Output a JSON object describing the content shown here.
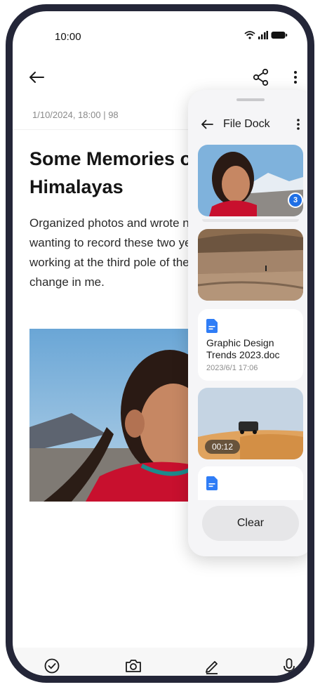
{
  "status_bar": {
    "time": "10:00"
  },
  "note": {
    "meta": "1/10/2024, 18:00  |  98",
    "title": "Some Memories of the Himalayas",
    "body": "Organized photos and wrote notes off and on, wanting to record these two years of living and working at the third pole of the earth brought a change in me."
  },
  "dock": {
    "title": "File Dock",
    "badge_count": "3",
    "items": [
      {
        "type": "image",
        "subject": "girl-portrait"
      },
      {
        "type": "image",
        "subject": "plateau-landscape"
      },
      {
        "type": "document",
        "name": "Graphic Design Trends 2023.doc",
        "date": "2023/6/1  17:06"
      },
      {
        "type": "video",
        "subject": "desert-car",
        "duration": "00:12"
      },
      {
        "type": "document"
      }
    ],
    "clear_label": "Clear"
  },
  "icons": {
    "top_bar": [
      "back-arrow-icon",
      "share-icon",
      "more-vertical-icon"
    ],
    "bottom_bar": [
      "checkbox-circle-icon",
      "camera-icon",
      "pen-icon",
      "microphone-icon"
    ]
  },
  "colors": {
    "frame": "#242638",
    "accent": "#1f6fe5",
    "doc_icon": "#2f7df6",
    "clear_button": "#e6e6e8"
  }
}
